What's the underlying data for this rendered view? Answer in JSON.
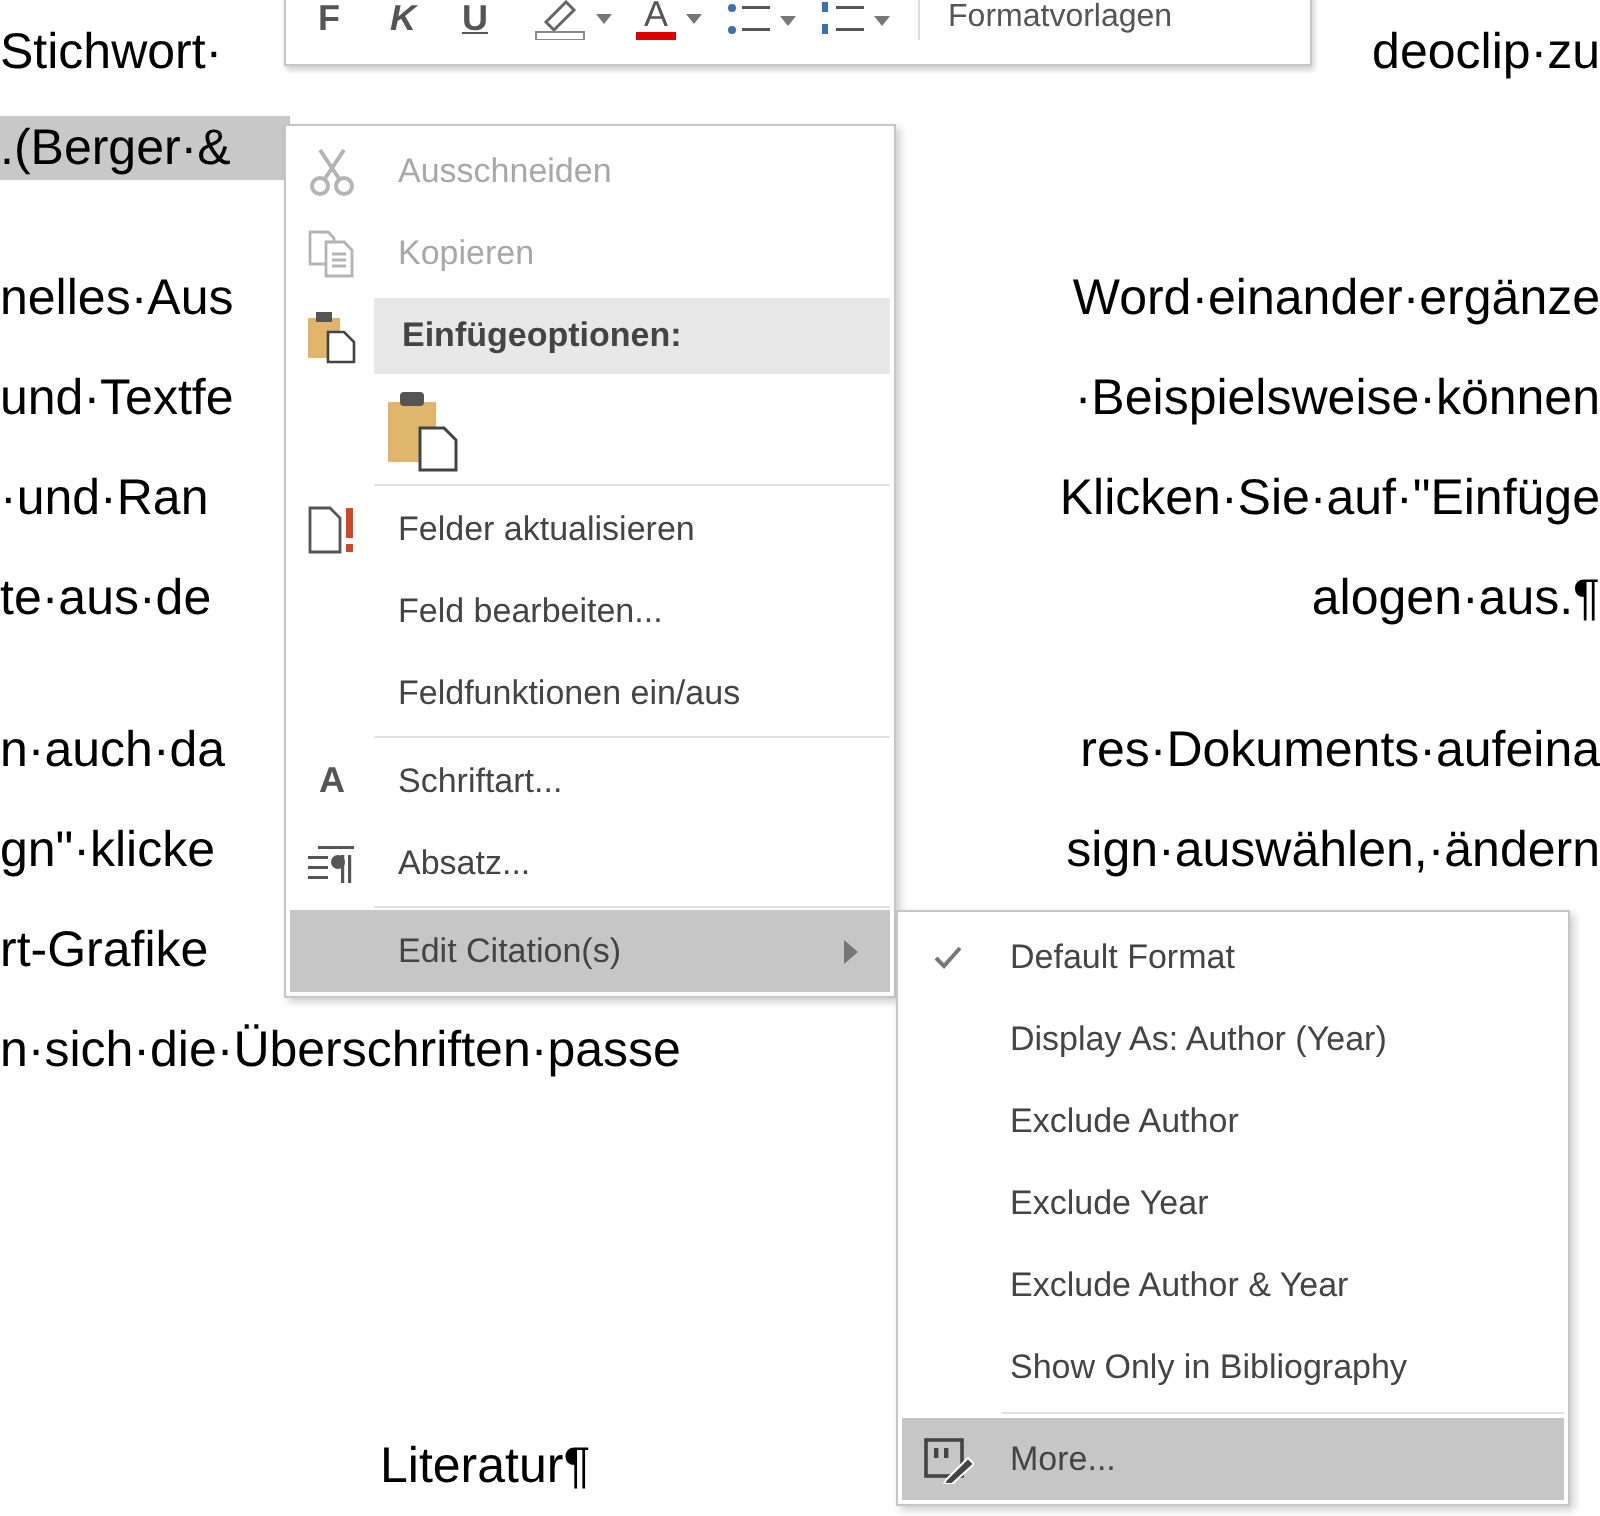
{
  "toolbar": {
    "buttons": [
      {
        "kind": "bold",
        "label": "F"
      },
      {
        "kind": "italic",
        "label": "K"
      },
      {
        "kind": "underline",
        "label": "U"
      }
    ],
    "font_color_label": "A",
    "styles_label": "Formatvorlagen"
  },
  "document": {
    "paragraphs": [
      {
        "lines": [
          {
            "left": "Stichwort·",
            "right": "deoclip·zu",
            "selected": false
          },
          {
            "left": ".(Berger·&",
            "selected": true
          }
        ]
      },
      {
        "lines": [
          {
            "left": "nelles·Aus",
            "right": "Word·einander·ergänze",
            "selected": false
          },
          {
            "left": "und·Textfe",
            "right": "·Beispielsweise·können",
            "selected": false
          },
          {
            "left": "·und·Ran",
            "right": "Klicken·Sie·auf·\"Einfüge",
            "selected": false
          },
          {
            "left": "te·aus·de",
            "right": "alogen·aus.¶",
            "selected": false
          }
        ]
      },
      {
        "lines": [
          {
            "left": "n·auch·da",
            "right": "res·Dokuments·aufeina",
            "selected": false
          },
          {
            "left": "gn\"·klicke",
            "right": "sign·auswählen,·ändern",
            "selected": false
          },
          {
            "left": "rt-Grafike",
            "selected": false
          },
          {
            "left": "n·sich·die·Überschriften·passe",
            "selected": false
          }
        ]
      }
    ],
    "heading": "Literatur¶"
  },
  "context_menu": {
    "items": [
      {
        "kind": "command",
        "label": "Ausschneiden",
        "disabled": true,
        "selected": false
      },
      {
        "kind": "command",
        "label": "Kopieren",
        "disabled": true,
        "selected": false
      },
      {
        "kind": "header",
        "label": "Einfügeoptionen:"
      },
      {
        "kind": "paste_option"
      },
      {
        "kind": "separator"
      },
      {
        "kind": "command",
        "label": "Felder aktualisieren",
        "disabled": false,
        "selected": false
      },
      {
        "kind": "command",
        "label": "Feld bearbeiten...",
        "disabled": false,
        "selected": false
      },
      {
        "kind": "command",
        "label": "Feldfunktionen ein/aus",
        "disabled": false,
        "selected": false
      },
      {
        "kind": "separator"
      },
      {
        "kind": "command",
        "label": "Schriftart...",
        "icon_text": "A",
        "disabled": false,
        "selected": false
      },
      {
        "kind": "command",
        "label": "Absatz...",
        "disabled": false,
        "selected": false
      },
      {
        "kind": "separator"
      },
      {
        "kind": "submenu",
        "label": "Edit Citation(s)",
        "disabled": false,
        "selected": true
      }
    ]
  },
  "citation_submenu": {
    "items": [
      {
        "kind": "option",
        "label": "Default Format",
        "checked": true,
        "selected": false
      },
      {
        "kind": "option",
        "label": "Display As: Author (Year)",
        "checked": false,
        "selected": false
      },
      {
        "kind": "option",
        "label": "Exclude Author",
        "checked": false,
        "selected": false
      },
      {
        "kind": "option",
        "label": "Exclude Year",
        "checked": false,
        "selected": false
      },
      {
        "kind": "option",
        "label": "Exclude Author & Year",
        "checked": false,
        "selected": false
      },
      {
        "kind": "option",
        "label": "Show Only in Bibliography",
        "checked": false,
        "selected": false
      },
      {
        "kind": "separator"
      },
      {
        "kind": "command",
        "label": "More...",
        "checked": false,
        "selected": true
      }
    ]
  }
}
